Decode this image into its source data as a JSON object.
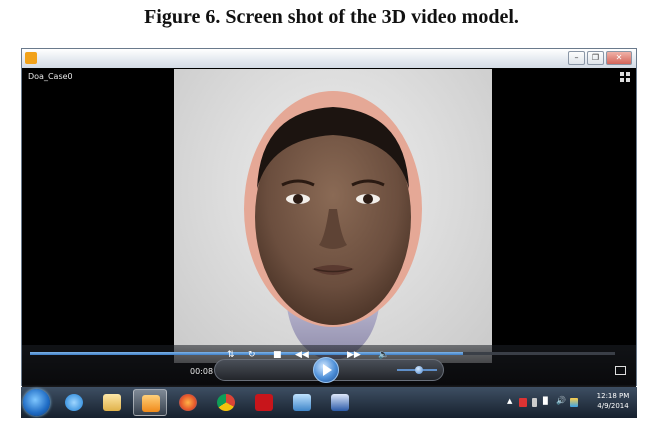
{
  "caption": "Figure 6. Screen shot of the 3D video model.",
  "window": {
    "video_title": "Doa_Case0",
    "buttons": [
      "minimize",
      "restore",
      "close"
    ],
    "icon": "media-player-icon"
  },
  "player": {
    "elapsed": "00:08",
    "progress": 0.74,
    "volume": 0.55,
    "controls": [
      "shuffle-icon",
      "repeat-icon",
      "stop-icon",
      "previous-icon",
      "play-icon",
      "next-icon",
      "volume-icon"
    ]
  },
  "taskbar": {
    "apps": [
      "internet-explorer-icon",
      "file-explorer-icon",
      "media-player-icon",
      "firefox-icon",
      "chrome-icon",
      "adobe-reader-icon",
      "image-viewer-icon",
      "word-icon"
    ],
    "active_app": "media-player-icon",
    "tray_icons": [
      "show-hidden-icon",
      "action-center-flag-icon",
      "battery-icon",
      "signal-icon",
      "speaker-icon",
      "drive-icon"
    ],
    "time": "12:18 PM",
    "date": "4/9/2014"
  },
  "colors": {
    "accent": "#3f7fc6",
    "taskbar": "#16202d",
    "video_bg": "#000000"
  }
}
